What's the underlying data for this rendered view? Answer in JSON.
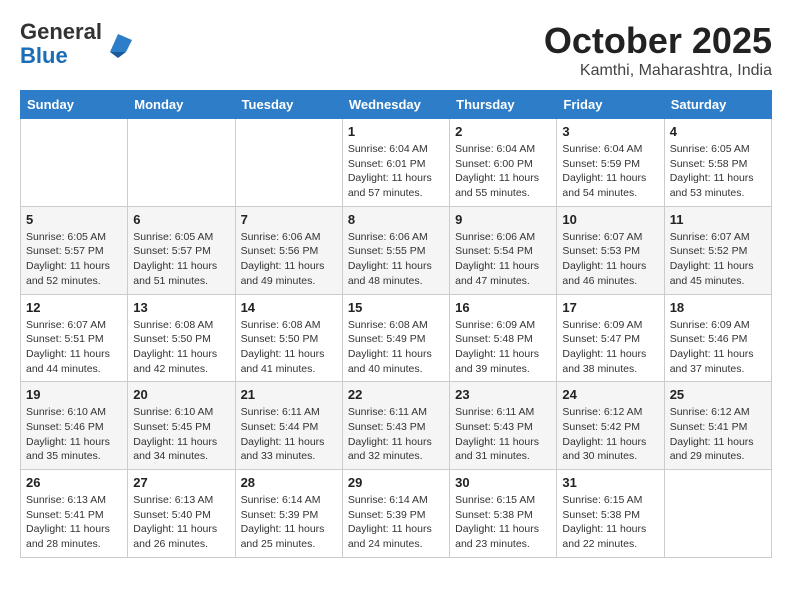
{
  "header": {
    "logo_general": "General",
    "logo_blue": "Blue",
    "month_title": "October 2025",
    "location": "Kamthi, Maharashtra, India"
  },
  "days_of_week": [
    "Sunday",
    "Monday",
    "Tuesday",
    "Wednesday",
    "Thursday",
    "Friday",
    "Saturday"
  ],
  "weeks": [
    [
      {
        "day": "",
        "info": ""
      },
      {
        "day": "",
        "info": ""
      },
      {
        "day": "",
        "info": ""
      },
      {
        "day": "1",
        "info": "Sunrise: 6:04 AM\nSunset: 6:01 PM\nDaylight: 11 hours\nand 57 minutes."
      },
      {
        "day": "2",
        "info": "Sunrise: 6:04 AM\nSunset: 6:00 PM\nDaylight: 11 hours\nand 55 minutes."
      },
      {
        "day": "3",
        "info": "Sunrise: 6:04 AM\nSunset: 5:59 PM\nDaylight: 11 hours\nand 54 minutes."
      },
      {
        "day": "4",
        "info": "Sunrise: 6:05 AM\nSunset: 5:58 PM\nDaylight: 11 hours\nand 53 minutes."
      }
    ],
    [
      {
        "day": "5",
        "info": "Sunrise: 6:05 AM\nSunset: 5:57 PM\nDaylight: 11 hours\nand 52 minutes."
      },
      {
        "day": "6",
        "info": "Sunrise: 6:05 AM\nSunset: 5:57 PM\nDaylight: 11 hours\nand 51 minutes."
      },
      {
        "day": "7",
        "info": "Sunrise: 6:06 AM\nSunset: 5:56 PM\nDaylight: 11 hours\nand 49 minutes."
      },
      {
        "day": "8",
        "info": "Sunrise: 6:06 AM\nSunset: 5:55 PM\nDaylight: 11 hours\nand 48 minutes."
      },
      {
        "day": "9",
        "info": "Sunrise: 6:06 AM\nSunset: 5:54 PM\nDaylight: 11 hours\nand 47 minutes."
      },
      {
        "day": "10",
        "info": "Sunrise: 6:07 AM\nSunset: 5:53 PM\nDaylight: 11 hours\nand 46 minutes."
      },
      {
        "day": "11",
        "info": "Sunrise: 6:07 AM\nSunset: 5:52 PM\nDaylight: 11 hours\nand 45 minutes."
      }
    ],
    [
      {
        "day": "12",
        "info": "Sunrise: 6:07 AM\nSunset: 5:51 PM\nDaylight: 11 hours\nand 44 minutes."
      },
      {
        "day": "13",
        "info": "Sunrise: 6:08 AM\nSunset: 5:50 PM\nDaylight: 11 hours\nand 42 minutes."
      },
      {
        "day": "14",
        "info": "Sunrise: 6:08 AM\nSunset: 5:50 PM\nDaylight: 11 hours\nand 41 minutes."
      },
      {
        "day": "15",
        "info": "Sunrise: 6:08 AM\nSunset: 5:49 PM\nDaylight: 11 hours\nand 40 minutes."
      },
      {
        "day": "16",
        "info": "Sunrise: 6:09 AM\nSunset: 5:48 PM\nDaylight: 11 hours\nand 39 minutes."
      },
      {
        "day": "17",
        "info": "Sunrise: 6:09 AM\nSunset: 5:47 PM\nDaylight: 11 hours\nand 38 minutes."
      },
      {
        "day": "18",
        "info": "Sunrise: 6:09 AM\nSunset: 5:46 PM\nDaylight: 11 hours\nand 37 minutes."
      }
    ],
    [
      {
        "day": "19",
        "info": "Sunrise: 6:10 AM\nSunset: 5:46 PM\nDaylight: 11 hours\nand 35 minutes."
      },
      {
        "day": "20",
        "info": "Sunrise: 6:10 AM\nSunset: 5:45 PM\nDaylight: 11 hours\nand 34 minutes."
      },
      {
        "day": "21",
        "info": "Sunrise: 6:11 AM\nSunset: 5:44 PM\nDaylight: 11 hours\nand 33 minutes."
      },
      {
        "day": "22",
        "info": "Sunrise: 6:11 AM\nSunset: 5:43 PM\nDaylight: 11 hours\nand 32 minutes."
      },
      {
        "day": "23",
        "info": "Sunrise: 6:11 AM\nSunset: 5:43 PM\nDaylight: 11 hours\nand 31 minutes."
      },
      {
        "day": "24",
        "info": "Sunrise: 6:12 AM\nSunset: 5:42 PM\nDaylight: 11 hours\nand 30 minutes."
      },
      {
        "day": "25",
        "info": "Sunrise: 6:12 AM\nSunset: 5:41 PM\nDaylight: 11 hours\nand 29 minutes."
      }
    ],
    [
      {
        "day": "26",
        "info": "Sunrise: 6:13 AM\nSunset: 5:41 PM\nDaylight: 11 hours\nand 28 minutes."
      },
      {
        "day": "27",
        "info": "Sunrise: 6:13 AM\nSunset: 5:40 PM\nDaylight: 11 hours\nand 26 minutes."
      },
      {
        "day": "28",
        "info": "Sunrise: 6:14 AM\nSunset: 5:39 PM\nDaylight: 11 hours\nand 25 minutes."
      },
      {
        "day": "29",
        "info": "Sunrise: 6:14 AM\nSunset: 5:39 PM\nDaylight: 11 hours\nand 24 minutes."
      },
      {
        "day": "30",
        "info": "Sunrise: 6:15 AM\nSunset: 5:38 PM\nDaylight: 11 hours\nand 23 minutes."
      },
      {
        "day": "31",
        "info": "Sunrise: 6:15 AM\nSunset: 5:38 PM\nDaylight: 11 hours\nand 22 minutes."
      },
      {
        "day": "",
        "info": ""
      }
    ]
  ]
}
